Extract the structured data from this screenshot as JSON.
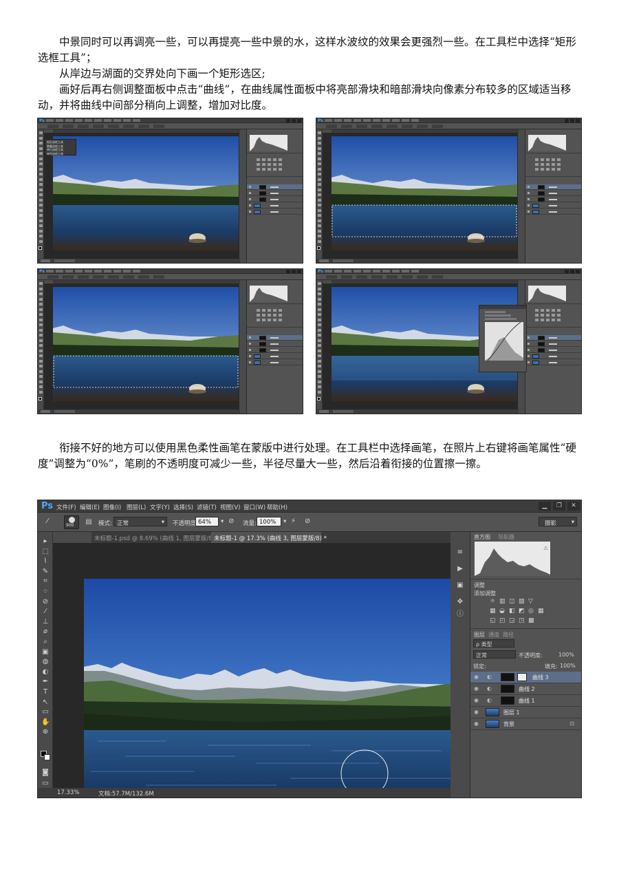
{
  "paragraphs": {
    "p1": "中景同时可以再调亮一些，可以再提亮一些中景的水，这样水波纹的效果会更强烈一些。在工具栏中选择“矩形选框工具”；",
    "p2": "从岸边与湖面的交界处向下画一个矩形选区;",
    "p3": "画好后再右侧调整面板中点击“曲线”，在曲线属性面板中将亮部滑块和暗部滑块向像素分布较多的区域适当移动，并将曲线中间部分稍向上调整，增加对比度。",
    "p4": "衔接不好的地方可以使用黑色柔性画笔在蒙版中进行处理。在工具栏中选择画笔，在照片上右键将画笔属性“硬度”调整为“0%”，笔刷的不透明度可减少一些，半径尽量大一些，然后沿着衔接的位置擦一擦。"
  },
  "ps": {
    "logo": "Ps",
    "menu": [
      "文件(F)",
      "编辑(E)",
      "图像(I)",
      "图层(L)",
      "文字(Y)",
      "选择(S)",
      "滤镜(T)",
      "视图(V)",
      "窗口(W)",
      "帮助(H)"
    ],
    "window_buttons": [
      "▁",
      "❐",
      "✕"
    ],
    "options": {
      "brush_size": "900",
      "mode_label": "模式:",
      "mode_value": "正常",
      "opacity_label": "不透明度:",
      "opacity_value": "64%",
      "flow_label": "流量:",
      "flow_value": "100%",
      "workspace": "摄影"
    },
    "tabs": [
      "未标题-1.psd @ 8.69% (曲线 1, 图层蒙版/8) *",
      "未标题-1 @ 17.3% (曲线 3, 图层蒙版/8) *"
    ],
    "panel_tabs": [
      "直方图",
      "导航器"
    ],
    "adjust_title": "调整",
    "adjust_add": "添加调整",
    "layers_tabs": [
      "图层",
      "通道",
      "路径"
    ],
    "layer_kind": "ρ 类型",
    "blend_mode": "正常",
    "layer_opacity_label": "不透明度:",
    "layer_opacity": "100%",
    "lock_label": "锁定:",
    "fill_label": "填充:",
    "fill_value": "100%",
    "layers": [
      "曲线 3",
      "曲线 2",
      "曲线 1",
      "图层 1",
      "背景"
    ],
    "zoom": "17.33%",
    "doc_info": "文档:57.7M/132.6M",
    "small_zoom": "17.33%",
    "small_doc_info": "文档:57.7M/132.6M"
  },
  "small_shot_tool_menu": [
    "矩形选框工具",
    "椭圆选框工具",
    "单行选框工具",
    "单列选框工具"
  ],
  "colors": {
    "sky_top": "#1f4ea8",
    "sky_bottom": "#8fb6e6",
    "water": "#1b3f6d",
    "ps_blue": "#4fa6ff"
  }
}
